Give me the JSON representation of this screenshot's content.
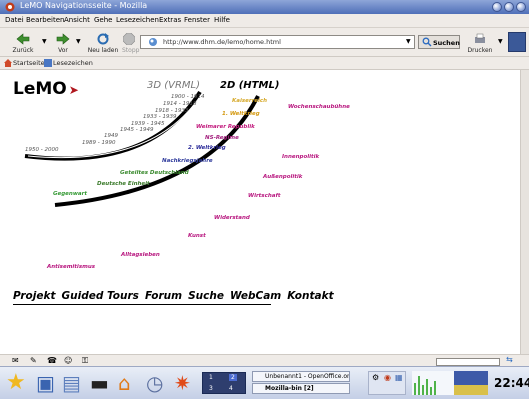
{
  "window": {
    "title": "LeMO Navigationsseite - Mozilla"
  },
  "menu": [
    "Datei",
    "Bearbeiten",
    "Ansicht",
    "Gehe",
    "Lesezeichen",
    "Extras",
    "Fenster",
    "Hilfe"
  ],
  "nav": {
    "back_label": "Zurück",
    "forward_label": "Vor",
    "reload_label": "Neu laden",
    "stop_label": "Stopp",
    "url": "http://www.dhm.de/lemo/home.html",
    "search_label": "Suchen",
    "print_label": "Drucken"
  },
  "bookmarks": {
    "home_label": "Startseite",
    "bookmarks_label": "Lesezeichen"
  },
  "page": {
    "logo": "LeMO",
    "heading_3d": "3D (VRML)",
    "heading_2d": "2D (HTML)",
    "years": [
      "1900 - 1914",
      "1914 - 1918",
      "1918 - 1933",
      "1933 - 1939",
      "1939 - 1945",
      "1945 - 1949",
      "1949",
      "1989 - 1990",
      "1950 - 2000"
    ],
    "eras": {
      "kaiserreich": "Kaiserreich",
      "ww1": "1. Weltkrieg",
      "weimar": "Weimarer Republik",
      "ns_regime": "NS-Regime",
      "ww2": "2. Weltkrieg",
      "nachkrieg": "Nachkriegsjahre",
      "geteiltes": "Geteiltes Deutschland",
      "einheit": "Deutsche Einheit",
      "gegenwart": "Gegenwart"
    },
    "topics": {
      "wochenschau": "Wochenschaubühne",
      "innenpolitik": "Innenpolitik",
      "aussenpolitik": "Außenpolitik",
      "wirtschaft": "Wirtschaft",
      "widerstand": "Widerstand",
      "kunst": "Kunst",
      "alltagsleben": "Alltagsleben",
      "antisemitismus": "Antisemitismus"
    },
    "main_nav": [
      "Projekt",
      "Guided Tours",
      "Forum",
      "Suche",
      "WebCam",
      "Kontakt"
    ]
  },
  "taskbar": {
    "tasks": [
      "Unbenannt1 - OpenOffice.org 1",
      "Mozilla-bin [2]"
    ],
    "workspaces": [
      "1",
      "2",
      "3",
      "4"
    ],
    "clock": "22:44"
  },
  "colors": {
    "kaiserreich": "#d6a92a",
    "ww1": "#d49a12",
    "weimar": "#c21a7d",
    "ns_regime": "#a4207e",
    "ww2": "#2b2b99",
    "nachkrieg": "#2f3b9c",
    "geteiltes": "#3a8a2e",
    "einheit": "#3a7a2a",
    "gegenwart": "#339933",
    "topic": "#b8177f",
    "arc": "#000000"
  }
}
